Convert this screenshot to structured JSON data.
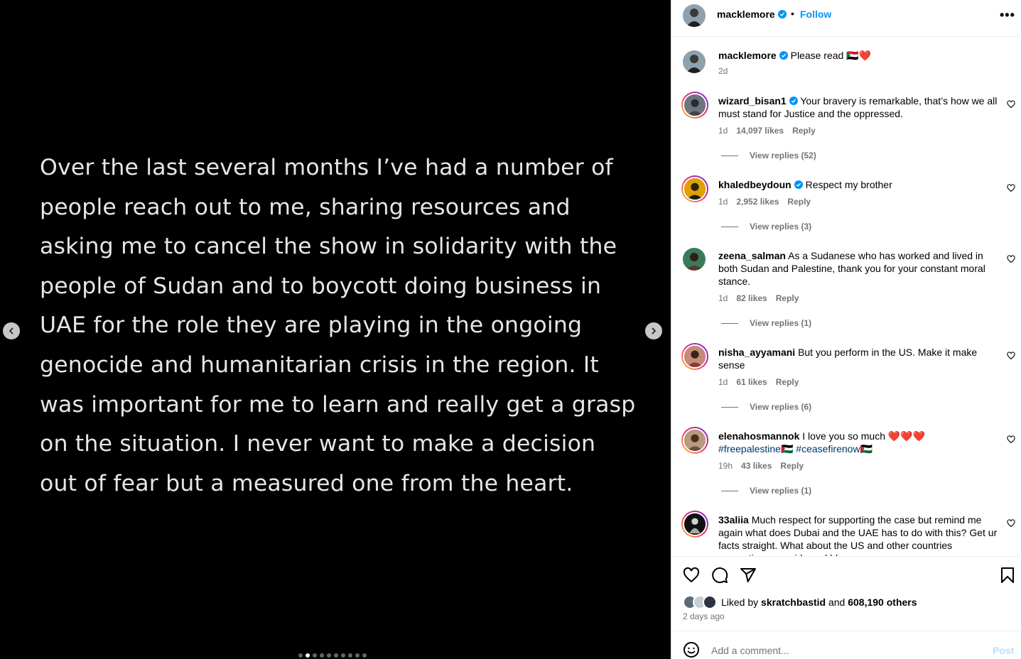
{
  "media": {
    "text": "Over the last several months I’ve had a number of people reach out to me, sharing resources and asking me to cancel the show in solidarity with the people of Sudan and to boycott doing business in UAE for the role they are playing in the ongoing genocide and humanitarian crisis in the region. It was important for me to learn and really get a grasp on the situation. I never want to make a decision out of fear but a measured one from the heart.",
    "slide_count": 10,
    "active_slide": 2
  },
  "header": {
    "username": "macklemore",
    "separator": "•",
    "follow_label": "Follow",
    "more_label": "•••"
  },
  "caption": {
    "username": "macklemore",
    "text": "Please read 🇸🇩❤️",
    "time": "2d"
  },
  "comments": [
    {
      "username": "wizard_bisan1",
      "verified": true,
      "text": "Your bravery is remarkable, that’s how we all must stand for Justice and the oppressed.",
      "time": "1d",
      "likes": "14,097 likes",
      "reply": "Reply",
      "view_replies": "View replies (52)"
    },
    {
      "username": "khaledbeydoun",
      "verified": true,
      "text": "Respect my brother",
      "time": "1d",
      "likes": "2,952 likes",
      "reply": "Reply",
      "view_replies": "View replies (3)"
    },
    {
      "username": "zeena_salman",
      "verified": false,
      "text": "As a Sudanese who has worked and lived in both Sudan and Palestine, thank you for your constant moral stance.",
      "time": "1d",
      "likes": "82 likes",
      "reply": "Reply",
      "view_replies": "View replies (1)"
    },
    {
      "username": "nisha_ayyamani",
      "verified": false,
      "text": "But you perform in the US. Make it make sense",
      "time": "1d",
      "likes": "61 likes",
      "reply": "Reply",
      "view_replies": "View replies (6)"
    },
    {
      "username": "elenahosmannok",
      "verified": false,
      "text": "I love you so much ❤️❤️❤️",
      "tag1": "#freepalestine🇵🇸",
      "tag2": "#ceasefirenow🇵🇸",
      "time": "19h",
      "likes": "43 likes",
      "reply": "Reply",
      "view_replies": "View replies (1)"
    },
    {
      "username": "33aliia",
      "verified": false,
      "text": "Much respect for supporting the case but remind me again what does Dubai and the UAE has to do with this? Get ur facts straight. What about the US and other countries supporting genocide and bl...",
      "time": "",
      "likes": "",
      "reply": "",
      "view_replies": ""
    }
  ],
  "actions": {
    "liked_by_prefix": "Liked by",
    "liked_by_user": "skratchbastid",
    "liked_by_and": "and",
    "liked_by_others": "608,190 others",
    "time_ago": "2 days ago"
  },
  "add_comment": {
    "placeholder": "Add a comment...",
    "post_label": "Post"
  },
  "colors": {
    "accent": "#0095f6",
    "verified": "#0095f6",
    "secondary_text": "#737373",
    "post_disabled": "#b9dffc",
    "hashtag": "#00376b"
  },
  "icons": [
    "chevron-left-icon",
    "chevron-right-icon",
    "verified-badge-icon",
    "more-icon",
    "heart-icon",
    "comment-icon",
    "share-icon",
    "bookmark-icon",
    "emoji-icon"
  ]
}
